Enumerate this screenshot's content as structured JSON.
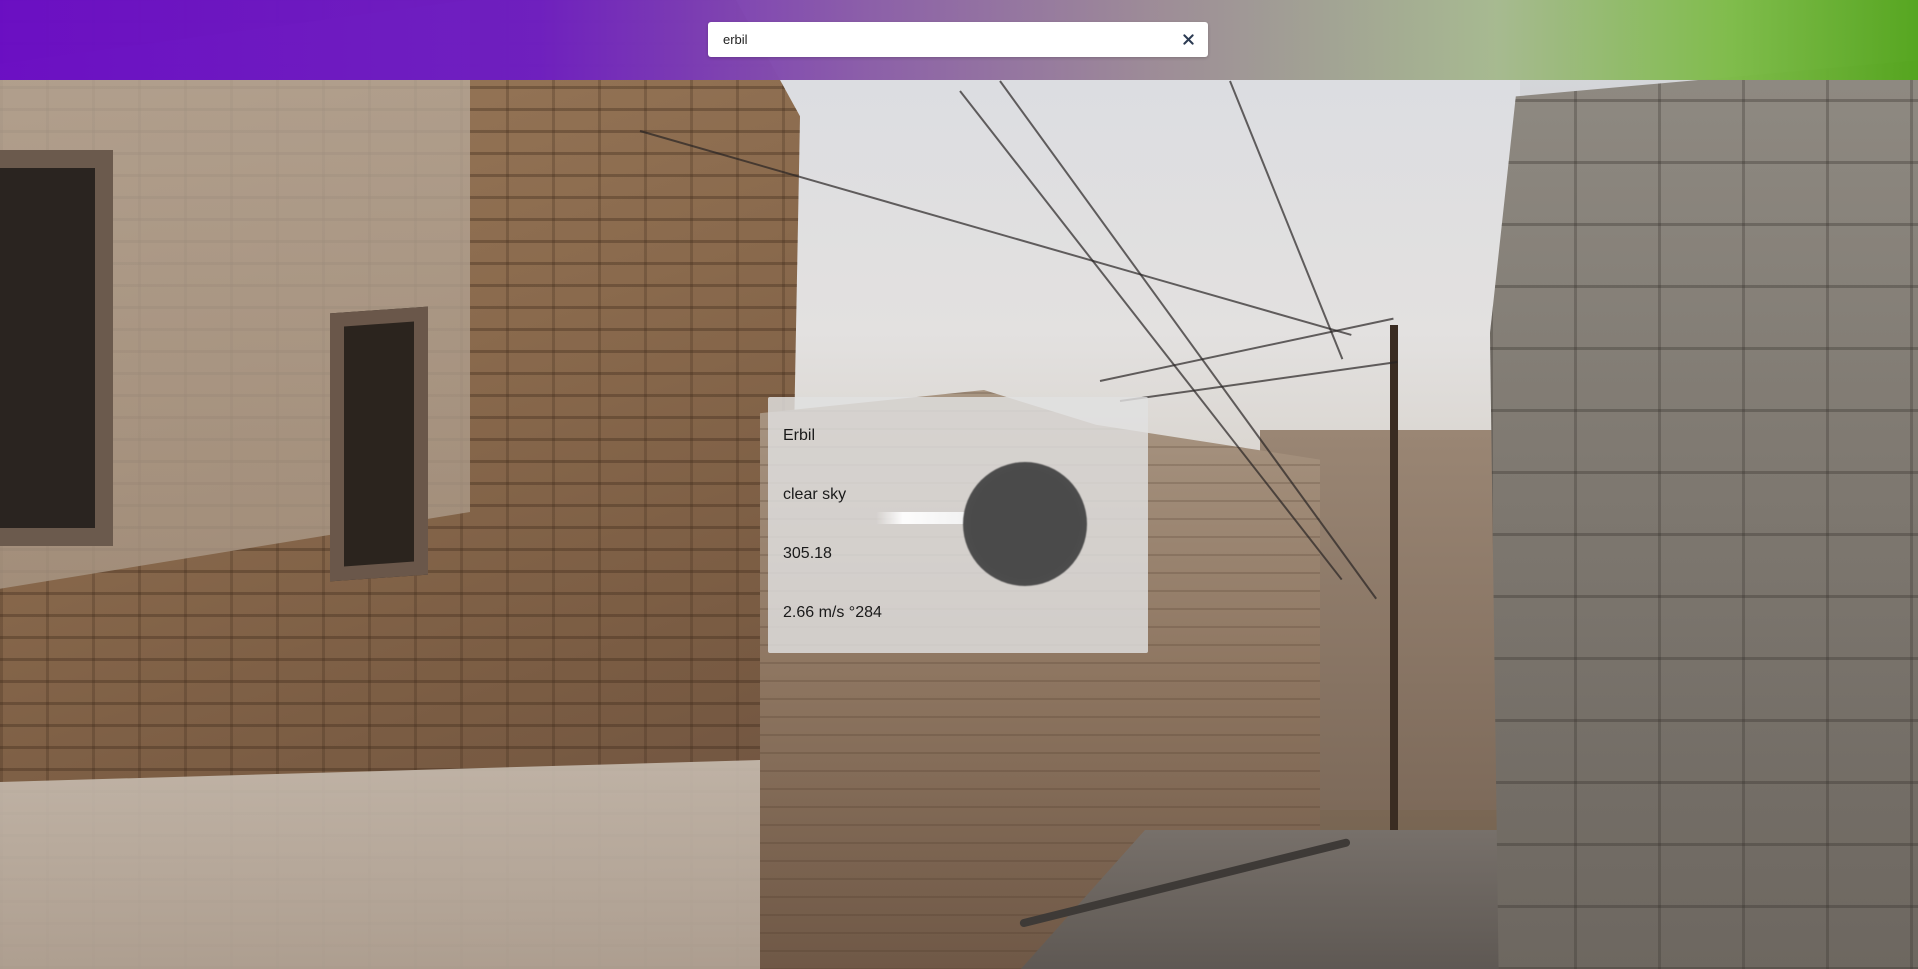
{
  "search": {
    "value": "erbil",
    "clear_label": "×"
  },
  "weather": {
    "city": "Erbil",
    "description": "clear sky",
    "temperature": "305.18",
    "wind": "2.66 m/s °284",
    "icon": "clear-sky-icon"
  },
  "colors": {
    "header_start": "#6a0dc4",
    "header_end": "#54a51d",
    "card_bg": "#e1e1e1"
  }
}
